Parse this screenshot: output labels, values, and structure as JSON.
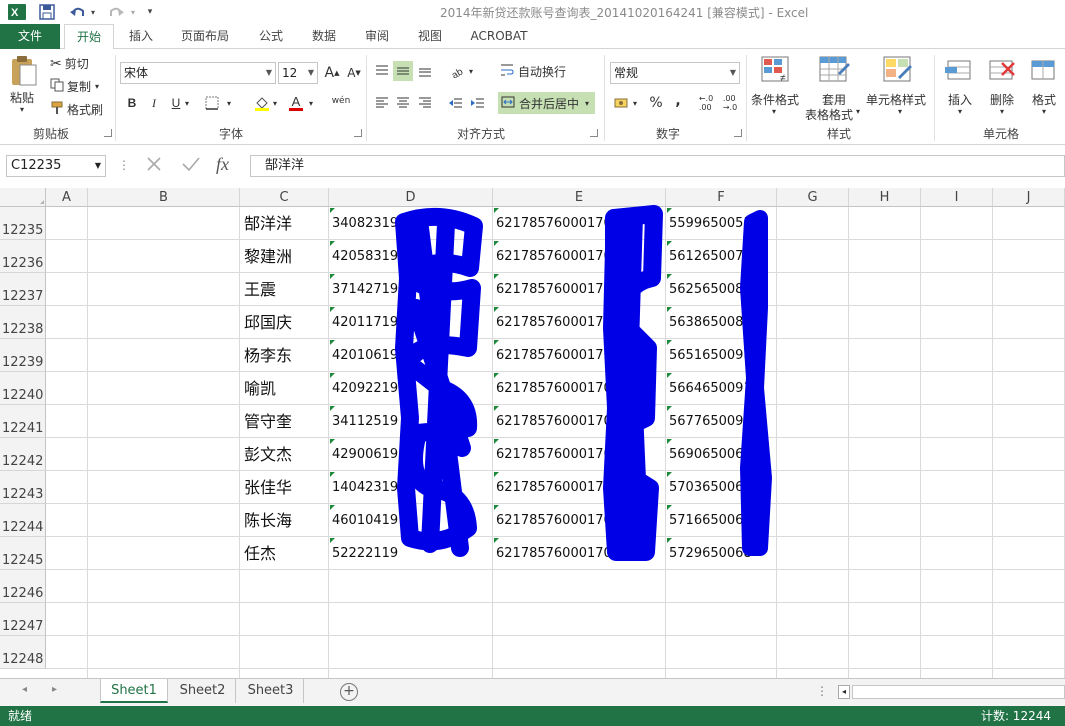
{
  "window": {
    "title": "2014年新贷还款账号查询表_20141020164241  [兼容模式] - Excel"
  },
  "tabs": [
    "文件",
    "开始",
    "插入",
    "页面布局",
    "公式",
    "数据",
    "审阅",
    "视图",
    "ACROBAT"
  ],
  "ribbon": {
    "clipboard": {
      "paste": "粘贴",
      "cut": "剪切",
      "copy": "复制",
      "format_painter": "格式刷",
      "label": "剪贴板"
    },
    "font": {
      "name": "宋体",
      "size": "12",
      "bold": "B",
      "italic": "I",
      "underline": "U",
      "font_color_letter": "A",
      "label": "字体",
      "phonetic": "wén"
    },
    "alignment": {
      "wrap": "自动换行",
      "merge": "合并后居中",
      "label": "对齐方式"
    },
    "number": {
      "format": "常规",
      "percent": "%",
      "comma": ",",
      "label": "数字"
    },
    "styles": {
      "conditional": "条件格式",
      "table_1": "套用",
      "table_2": "表格格式",
      "cell_styles": "单元格样式",
      "label": "样式"
    },
    "cells": {
      "insert": "插入",
      "delete": "删除",
      "format": "格式",
      "label": "单元格"
    }
  },
  "formula_bar": {
    "name_box": "C12235",
    "fx": "fx",
    "content": "郜洋洋"
  },
  "columns": [
    "A",
    "B",
    "C",
    "D",
    "E",
    "F",
    "G",
    "H",
    "I",
    "J"
  ],
  "rows": [
    {
      "num": "12235",
      "name": "郜洋洋",
      "d": "34082319",
      "e": "621785760001706",
      "f": "5599650055"
    },
    {
      "num": "12236",
      "name": "黎建洲",
      "d": "42058319",
      "e": "621785760001705",
      "f": "5612650070"
    },
    {
      "num": "12237",
      "name": "王震",
      "d": "37142719",
      "e": "621785760001706",
      "f": "5625650081"
    },
    {
      "num": "12238",
      "name": "邱国庆",
      "d": "42011719",
      "e": "621785760001705",
      "f": "5638650089"
    },
    {
      "num": "12239",
      "name": "杨李东",
      "d": "42010619",
      "e": "621785760001705",
      "f": "5651650098"
    },
    {
      "num": "12240",
      "name": "喻凯",
      "d": "42092219",
      "e": "621785760001705",
      "f": "5664650091"
    },
    {
      "num": "12241",
      "name": "管守奎",
      "d": "34112519",
      "e": "621785760001706",
      "f": "5677650095"
    },
    {
      "num": "12242",
      "name": "彭文杰",
      "d": "42900619",
      "e": "621785760001706",
      "f": "5690650063"
    },
    {
      "num": "12243",
      "name": "张佳华",
      "d": "14042319",
      "e": "621785760001706",
      "f": "5703650061"
    },
    {
      "num": "12244",
      "name": "陈长海",
      "d": "46010419",
      "e": "621785760001705",
      "f": "5716650065"
    },
    {
      "num": "12245",
      "name": "任杰",
      "d": "52222119",
      "e": "621785760001706",
      "f": "5729650068"
    },
    {
      "num": "12246",
      "name": "",
      "d": "",
      "e": "",
      "f": ""
    },
    {
      "num": "12247",
      "name": "",
      "d": "",
      "e": "",
      "f": ""
    },
    {
      "num": "12248",
      "name": "",
      "d": "",
      "e": "",
      "f": ""
    }
  ],
  "sheets": [
    "Sheet1",
    "Sheet2",
    "Sheet3"
  ],
  "status": {
    "ready": "就绪",
    "count": "计数: 12244"
  },
  "colors": {
    "excel_green": "#217346",
    "redaction": "#0000e6"
  },
  "icons": [
    "excel-logo-icon",
    "save-icon",
    "undo-icon",
    "redo-icon",
    "customize-icon",
    "paste-icon",
    "cut-icon",
    "copy-icon",
    "format-painter-icon",
    "cancel-icon",
    "enter-icon",
    "function-icon",
    "add-sheet-icon"
  ]
}
